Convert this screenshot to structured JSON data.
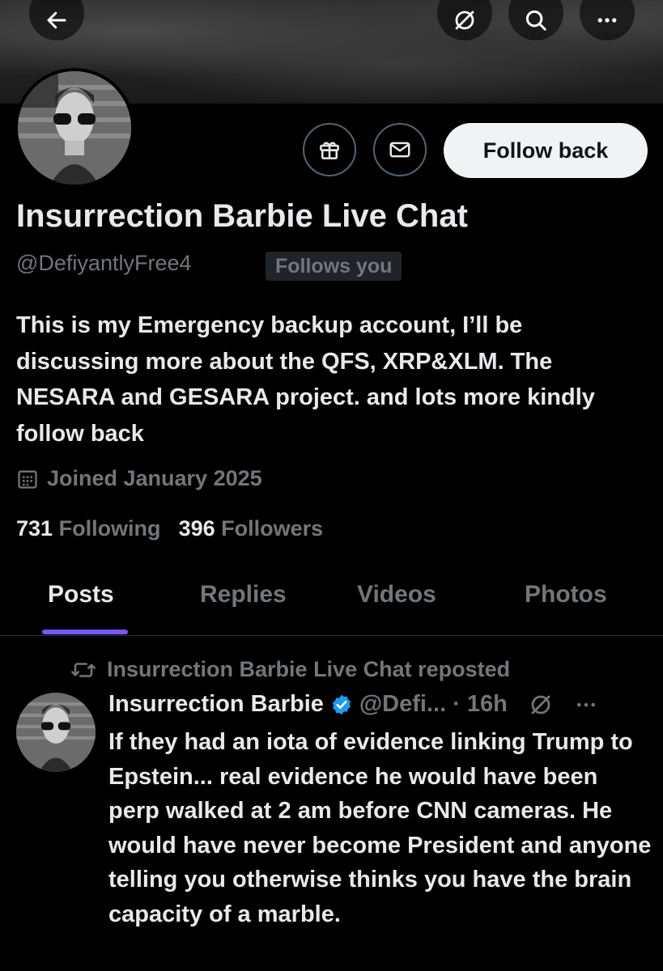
{
  "profile": {
    "name": "Insurrection Barbie Live Chat",
    "handle": "@DefiyantlyFree4",
    "follows_you": "Follows you",
    "bio": "This is my Emergency backup account, I’ll be discussing more about the QFS, XRP&XLM. The NESARA and GESARA project. and lots more kindly follow back",
    "joined": "Joined January 2025",
    "following_count": "731",
    "following_label": "Following",
    "followers_count": "396",
    "followers_label": "Followers",
    "follow_button": "Follow back"
  },
  "tabs": [
    {
      "label": "Posts"
    },
    {
      "label": "Replies"
    },
    {
      "label": "Videos"
    },
    {
      "label": "Photos"
    }
  ],
  "post": {
    "repost_label": "Insurrection Barbie Live Chat reposted",
    "author": "Insurrection Barbie",
    "handle": "@Defi...",
    "time": "· 16h",
    "text": "If they had an iota of evidence linking Trump to Epstein... real evidence he would have been perp walked at 2 am before CNN cameras. He would have never become President and anyone telling you otherwise thinks you have the brain capacity of a marble."
  },
  "colors": {
    "background": "#000000",
    "text_primary": "#e7e9ea",
    "text_secondary": "#71767b",
    "accent_tab": "#7856ff",
    "verified": "#1d9bf0",
    "follow_button_bg": "#eff3f4"
  },
  "icons": [
    "back-arrow-icon",
    "grok-icon",
    "search-icon",
    "more-icon",
    "gift-icon",
    "mail-icon",
    "calendar-icon",
    "repost-icon",
    "verified-badge-icon",
    "grok-icon",
    "more-icon"
  ]
}
